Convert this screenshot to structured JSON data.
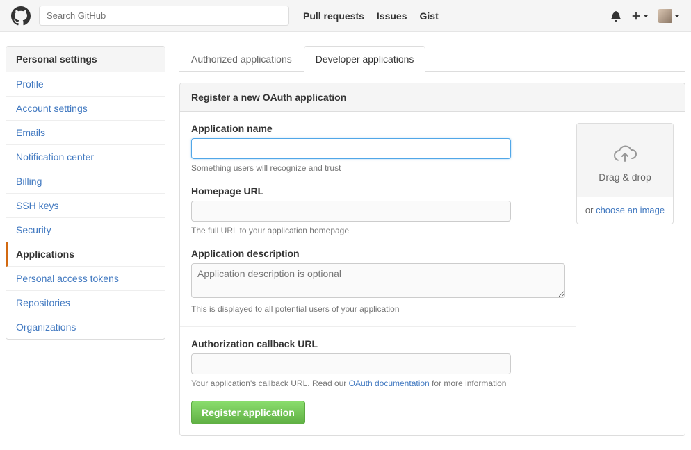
{
  "header": {
    "search_placeholder": "Search GitHub",
    "nav": [
      "Pull requests",
      "Issues",
      "Gist"
    ]
  },
  "sidebar": {
    "title": "Personal settings",
    "items": [
      {
        "label": "Profile",
        "active": false
      },
      {
        "label": "Account settings",
        "active": false
      },
      {
        "label": "Emails",
        "active": false
      },
      {
        "label": "Notification center",
        "active": false
      },
      {
        "label": "Billing",
        "active": false
      },
      {
        "label": "SSH keys",
        "active": false
      },
      {
        "label": "Security",
        "active": false
      },
      {
        "label": "Applications",
        "active": true
      },
      {
        "label": "Personal access tokens",
        "active": false
      },
      {
        "label": "Repositories",
        "active": false
      },
      {
        "label": "Organizations",
        "active": false
      }
    ]
  },
  "tabs": {
    "authorized": "Authorized applications",
    "developer": "Developer applications"
  },
  "panel": {
    "title": "Register a new OAuth application",
    "app_name": {
      "label": "Application name",
      "value": "",
      "hint": "Something users will recognize and trust"
    },
    "homepage": {
      "label": "Homepage URL",
      "value": "",
      "hint": "The full URL to your application homepage"
    },
    "description": {
      "label": "Application description",
      "placeholder": "Application description is optional",
      "hint": "This is displayed to all potential users of your application"
    },
    "callback": {
      "label": "Authorization callback URL",
      "value": "",
      "hint_pre": "Your application's callback URL. Read our ",
      "hint_link": "OAuth documentation",
      "hint_post": " for more information"
    },
    "submit": "Register application",
    "upload": {
      "drag": "Drag & drop",
      "or": "or ",
      "choose": "choose an image"
    }
  }
}
